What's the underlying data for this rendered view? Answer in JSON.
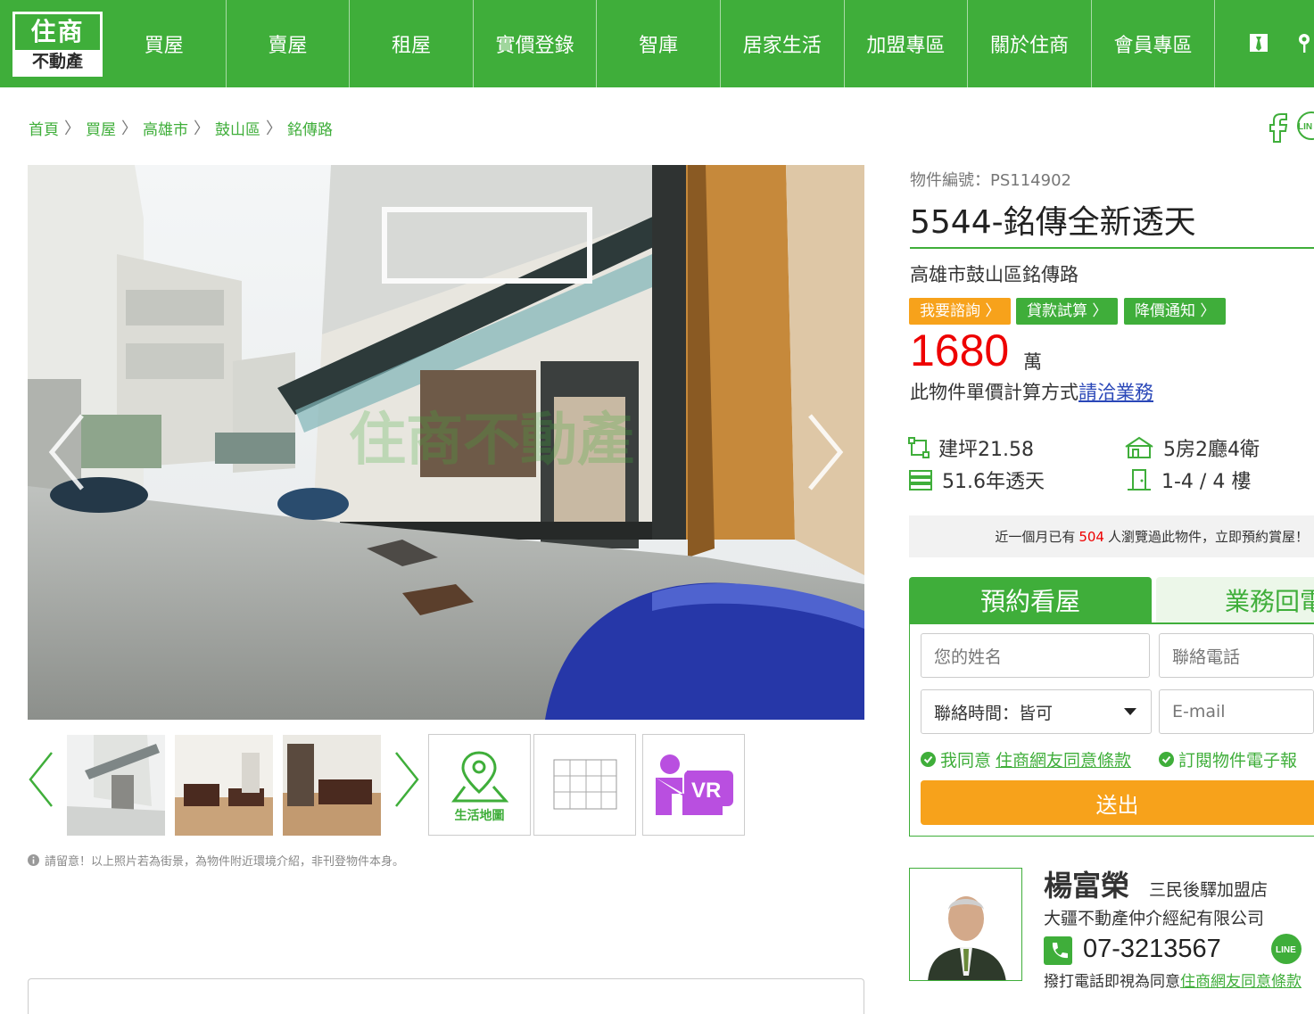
{
  "logo": {
    "line1": "住商",
    "line2": "不動產"
  },
  "nav": [
    "買屋",
    "賣屋",
    "租屋",
    "實價登錄",
    "智庫",
    "居家生活",
    "加盟專區",
    "關於住商",
    "會員專區"
  ],
  "breadcrumb": [
    "首頁",
    "買屋",
    "高雄市",
    "鼓山區",
    "銘傳路"
  ],
  "listing": {
    "id_label": "物件編號：PS114902",
    "title": "5544-銘傳全新透天",
    "address": "高雄市鼓山區銘傳路",
    "tags": [
      "我要諮詢",
      "貸款試算",
      "降價通知"
    ],
    "price": "1680",
    "price_unit": "萬",
    "unit_note": "此物件單價計算方式",
    "unit_link": "請洽業務",
    "specs": {
      "area": "建坪21.58",
      "layout": "5房2廳4衛",
      "age": "51.6年透天",
      "floor": "1-4 / 4 樓"
    },
    "views": {
      "prefix": "近一個月已有",
      "count": "504",
      "suffix": "人瀏覽過此物件，立即預約賞屋！"
    }
  },
  "gallery": {
    "map_label": "生活地圖",
    "vr_label": "VR",
    "watermark": "住商不動產",
    "notice": "請留意！以上照片若為街景，為物件附近環境介紹，非刊登物件本身。"
  },
  "form": {
    "tab_book": "預約看屋",
    "tab_callback": "業務回電",
    "name_placeholder": "您的姓名",
    "phone_placeholder": "聯絡電話",
    "time_select": "聯絡時間：皆可",
    "email_placeholder": "E-mail",
    "agree_prefix": "我同意",
    "agree_link": "住商網友同意條款",
    "subscribe": "訂閱物件電子報",
    "submit": "送出"
  },
  "agent": {
    "name": "楊富榮",
    "store": "三民後驛加盟店",
    "company": "大疆不動產仲介經紀有限公司",
    "phone": "07-3213567",
    "note_prefix": "撥打電話即視為同意",
    "note_link": "住商網友同意條款",
    "line_badge": "LINE"
  },
  "colors": {
    "brand_green": "#3fae3a",
    "price_red": "#e00000",
    "orange": "#f7a21b",
    "purple": "#b94fe0"
  }
}
